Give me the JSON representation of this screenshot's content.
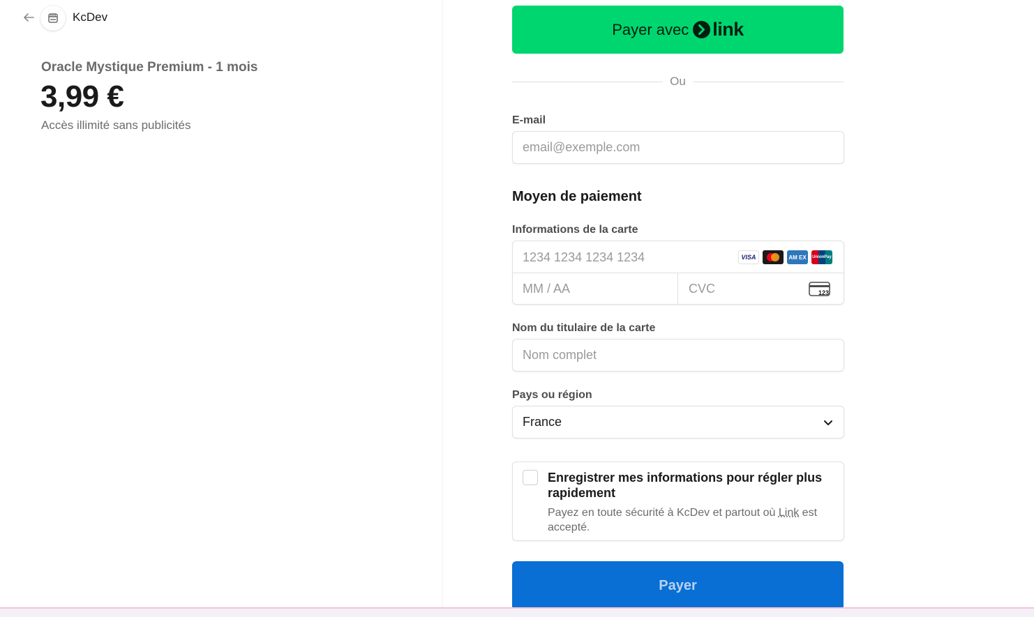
{
  "merchant": {
    "name": "KcDev",
    "back_icon": "arrow-left-icon",
    "logo_icon": "store-icon"
  },
  "product": {
    "name": "Oracle Mystique Premium - 1 mois",
    "price": "3,99 €",
    "description": "Accès illimité sans publicités"
  },
  "form": {
    "link_button": {
      "prefix": "Payer avec",
      "brand": "link",
      "color": "#00d66f"
    },
    "or_text": "Ou",
    "email": {
      "label": "E-mail",
      "placeholder": "email@exemple.com"
    },
    "payment_title": "Moyen de paiement",
    "card": {
      "label": "Informations de la carte",
      "number_placeholder": "1234 1234 1234 1234",
      "expiry_placeholder": "MM / AA",
      "cvc_placeholder": "CVC",
      "brands": [
        "VISA",
        "Mastercard",
        "American Express",
        "UnionPay"
      ]
    },
    "cardholder": {
      "label": "Nom du titulaire de la carte",
      "placeholder": "Nom complet"
    },
    "country": {
      "label": "Pays ou région",
      "selected": "France"
    },
    "save": {
      "title": "Enregistrer mes informations pour régler plus rapidement",
      "desc_before": "Payez en toute sécurité à KcDev et partout où ",
      "desc_link": "Link",
      "desc_after": " est accepté.",
      "checked": false
    },
    "pay_button": {
      "label": "Payer",
      "color": "#0a6fd4"
    }
  }
}
